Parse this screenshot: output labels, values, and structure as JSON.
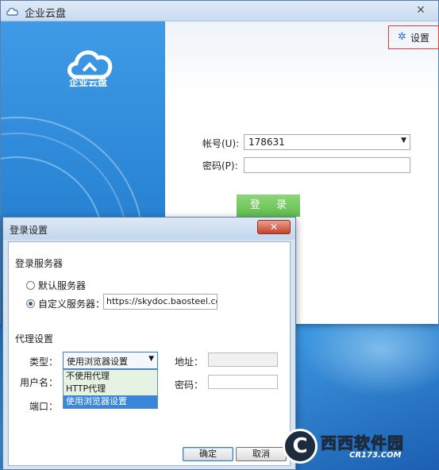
{
  "main_window": {
    "title": "企业云盘",
    "close_glyph": "✕",
    "logo_text": "企业云盘",
    "settings_label": "设置",
    "account_label": "帐号(U):",
    "account_value": "178631",
    "password_label": "密码(P):",
    "login_label": "登 录"
  },
  "dialog": {
    "title": "登录设置",
    "close_glyph": "✕",
    "server_section": "登录服务器",
    "default_server_label": "默认服务器",
    "custom_server_label": "自定义服务器：",
    "custom_server_value": "https://skydoc.baosteel.com",
    "proxy_section": "代理设置",
    "type_label": "类型：",
    "type_value": "使用浏览器设置",
    "type_options": [
      "不使用代理",
      "HTTP代理",
      "使用浏览器设置"
    ],
    "address_label": "地址：",
    "username_label": "用户名：",
    "password_label": "密码：",
    "port_label": "端口：",
    "ok_label": "确定",
    "cancel_label": "取消"
  },
  "watermark": {
    "letter": "C",
    "brand_part1": "西西",
    "brand_part2": "软件园",
    "site": "CR173.COM"
  },
  "colors": {
    "accent_blue": "#2b86d6",
    "login_green": "#5fbd4b",
    "highlight_red": "#e03a3a",
    "selection_blue": "#3a86d8"
  }
}
